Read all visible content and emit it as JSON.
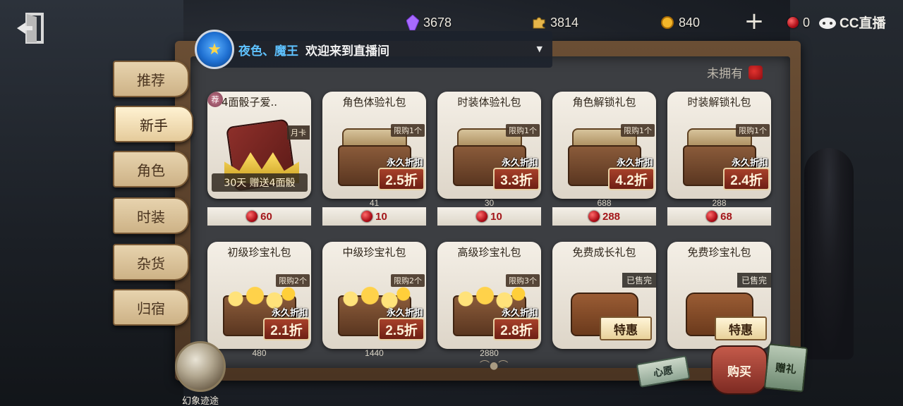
{
  "topbar": {
    "gems": "3678",
    "puzzle": "3814",
    "coins": "840",
    "red": "0",
    "brand": "CC直播"
  },
  "notice": {
    "user": "夜色、魔王",
    "text": "欢迎来到直播间"
  },
  "panel": {
    "not_owned": "未拥有"
  },
  "tabs": [
    "推荐",
    "新手",
    "角色",
    "时装",
    "杂货",
    "归宿"
  ],
  "cards": [
    {
      "title": "4面骰子爱..",
      "tag": "月卡",
      "bonus": "30天  赠送4面骰",
      "price": "60",
      "strike": "",
      "badge": "荐"
    },
    {
      "title": "角色体验礼包",
      "limit": "限购1个",
      "perm": "永久折扣",
      "discount": "2.5折",
      "price": "10",
      "strike": "41"
    },
    {
      "title": "时装体验礼包",
      "limit": "限购1个",
      "perm": "永久折扣",
      "discount": "3.3折",
      "price": "10",
      "strike": "30"
    },
    {
      "title": "角色解锁礼包",
      "limit": "限购1个",
      "perm": "永久折扣",
      "discount": "4.2折",
      "price": "288",
      "strike": "688"
    },
    {
      "title": "时装解锁礼包",
      "limit": "限购1个",
      "perm": "永久折扣",
      "discount": "2.4折",
      "price": "68",
      "strike": "288"
    },
    {
      "title": "初级珍宝礼包",
      "limit": "限购2个",
      "perm": "永久折扣",
      "discount": "2.1折",
      "strike": "480"
    },
    {
      "title": "中级珍宝礼包",
      "limit": "限购2个",
      "perm": "永久折扣",
      "discount": "2.5折",
      "strike": "1440"
    },
    {
      "title": "高级珍宝礼包",
      "limit": "限购3个",
      "perm": "永久折扣",
      "discount": "2.8折",
      "strike": "2880"
    },
    {
      "title": "免费成长礼包",
      "sold": "已售完",
      "special": "特惠"
    },
    {
      "title": "免费珍宝礼包",
      "sold": "已售完",
      "special": "特惠"
    }
  ],
  "bottom": {
    "portal_label": "幻象迹途",
    "wish": "心愿",
    "buy": "购买",
    "gift": "赠礼"
  }
}
